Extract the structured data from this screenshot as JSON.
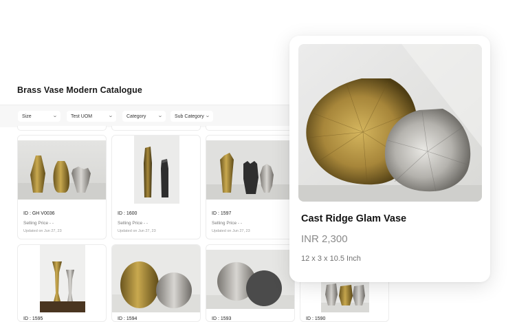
{
  "catalogue": {
    "title": "Brass Vase Modern Catalogue"
  },
  "filters": [
    {
      "label": "Size"
    },
    {
      "label": "Test UOM"
    },
    {
      "label": "Category"
    },
    {
      "label": "Sub Category"
    }
  ],
  "products": [
    {
      "id": "ID : GH V0036",
      "selling_price": "Selling Price - -",
      "updated": "Updated on Jun 27, 23"
    },
    {
      "id": "ID : 1600",
      "selling_price": "Selling Price - -",
      "updated": "Updated on Jun 27, 23"
    },
    {
      "id": "ID : 1597",
      "selling_price": "Selling Price - -",
      "updated": "Updated on Jun 27, 23"
    }
  ],
  "lower_row": [
    {
      "id": "ID : 1595"
    },
    {
      "id": "ID : 1594"
    },
    {
      "id": "ID : 1593"
    },
    {
      "id": "ID : 1590"
    }
  ],
  "featured": {
    "name": "Cast Ridge Glam Vase",
    "price": "INR 2,300",
    "dimensions": "12 x 3 x 10.5 Inch"
  },
  "colors": {
    "brass": "#a8893a",
    "silver": "#b9b7b2",
    "black": "#2e2e2e",
    "background_photo": "#e6e6e4"
  }
}
